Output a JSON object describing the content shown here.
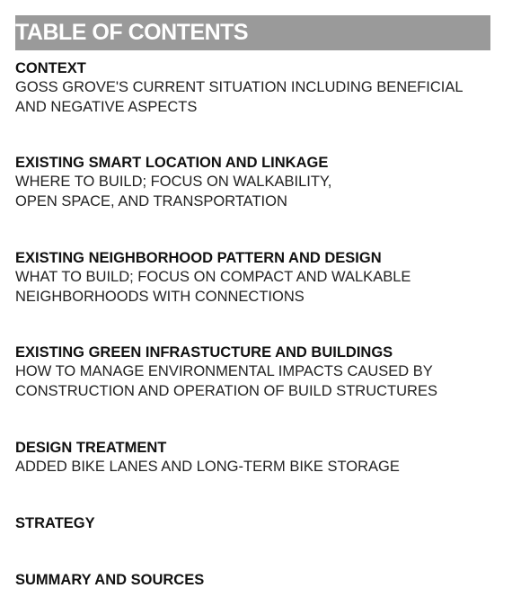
{
  "title": "TABLE OF CONTENTS",
  "entries": [
    {
      "heading": "CONTEXT",
      "lines": [
        "GOSS GROVE'S CURRENT SITUATION INCLUDING BENEFICIAL",
        "AND NEGATIVE ASPECTS"
      ]
    },
    {
      "heading": "EXISTING SMART LOCATION AND LINKAGE",
      "lines": [
        "WHERE TO BUILD; FOCUS ON WALKABILITY,",
        "OPEN SPACE, AND TRANSPORTATION"
      ]
    },
    {
      "heading": "EXISTING NEIGHBORHOOD PATTERN AND DESIGN",
      "lines": [
        "WHAT TO BUILD; FOCUS ON COMPACT AND WALKABLE",
        "NEIGHBORHOODS WITH CONNECTIONS"
      ]
    },
    {
      "heading": "EXISTING GREEN INFRASTUCTURE AND BUILDINGS",
      "lines": [
        "HOW TO MANAGE ENVIRONMENTAL IMPACTS CAUSED BY",
        "CONSTRUCTION AND OPERATION OF BUILD STRUCTURES"
      ]
    },
    {
      "heading": "DESIGN TREATMENT",
      "lines": [
        "ADDED BIKE LANES AND LONG-TERM BIKE STORAGE"
      ]
    },
    {
      "heading": "STRATEGY",
      "lines": []
    },
    {
      "heading": "SUMMARY AND SOURCES",
      "lines": []
    }
  ]
}
